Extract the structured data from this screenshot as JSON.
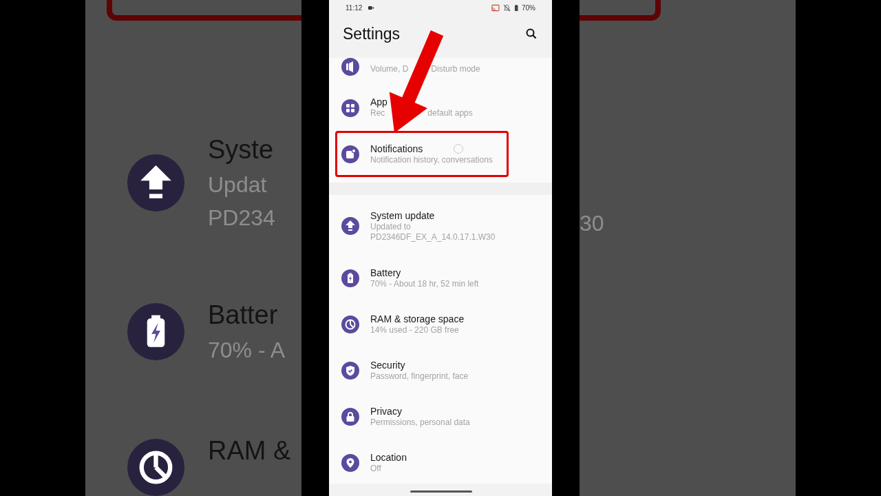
{
  "backdrop": {
    "left_rows": [
      {
        "kind": "update",
        "title": "Syste",
        "subtitle": [
          "Updat",
          "PD234"
        ]
      },
      {
        "kind": "battery",
        "title": "Batter",
        "subtitle": [
          "70% - A"
        ]
      },
      {
        "kind": "storage",
        "title": "RAM &",
        "subtitle": []
      }
    ],
    "right_texts": [
      "30"
    ]
  },
  "status_bar": {
    "time": "11:12",
    "battery": "70%"
  },
  "header": {
    "title": "Settings"
  },
  "sections": [
    {
      "items": [
        {
          "kind": "sound",
          "subtitle_parts": [
            "Volume, D",
            "Disturb mode"
          ],
          "highlighted": false
        },
        {
          "kind": "apps",
          "title": "App",
          "subtitle_parts": [
            "Rec",
            "default apps"
          ],
          "highlighted": false
        },
        {
          "kind": "notifications",
          "title": "Notifications",
          "subtitle_parts": [
            "Notification history, conversations"
          ],
          "highlighted": true
        }
      ]
    },
    {
      "items": [
        {
          "kind": "update",
          "title": "System update",
          "subtitle_parts": [
            "Updated to PD2346DF_EX_A_14.0.17.1.W30"
          ],
          "highlighted": false
        },
        {
          "kind": "battery",
          "title": "Battery",
          "subtitle_parts": [
            "70% - About 18 hr, 52 min left"
          ],
          "highlighted": false
        },
        {
          "kind": "storage",
          "title": "RAM & storage space",
          "subtitle_parts": [
            "14% used - 220 GB free"
          ],
          "highlighted": false
        },
        {
          "kind": "security",
          "title": "Security",
          "subtitle_parts": [
            "Password, fingerprint, face"
          ],
          "highlighted": false
        },
        {
          "kind": "privacy",
          "title": "Privacy",
          "subtitle_parts": [
            "Permissions, personal data"
          ],
          "highlighted": false
        },
        {
          "kind": "location",
          "title": "Location",
          "subtitle_parts": [
            "Off"
          ],
          "highlighted": false
        }
      ]
    }
  ]
}
